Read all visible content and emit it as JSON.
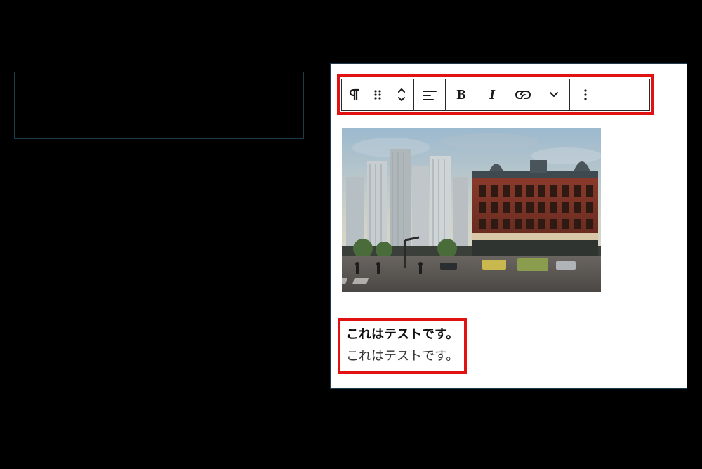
{
  "left_panel": {},
  "editor": {
    "toolbar": {
      "block_type_icon": "pilcrow-icon",
      "drag_icon": "drag-handle-icon",
      "move_icon": "move-up-down-icon",
      "align_icon": "align-left-icon",
      "bold_label": "B",
      "italic_label": "I",
      "link_icon": "link-icon",
      "more_rich_icon": "chevron-down-icon",
      "options_icon": "more-vertical-icon"
    },
    "image": {
      "alt": "city-building-photo"
    },
    "text": {
      "bold_line": "これはテストです。",
      "plain_line": "これはテストです。"
    }
  }
}
